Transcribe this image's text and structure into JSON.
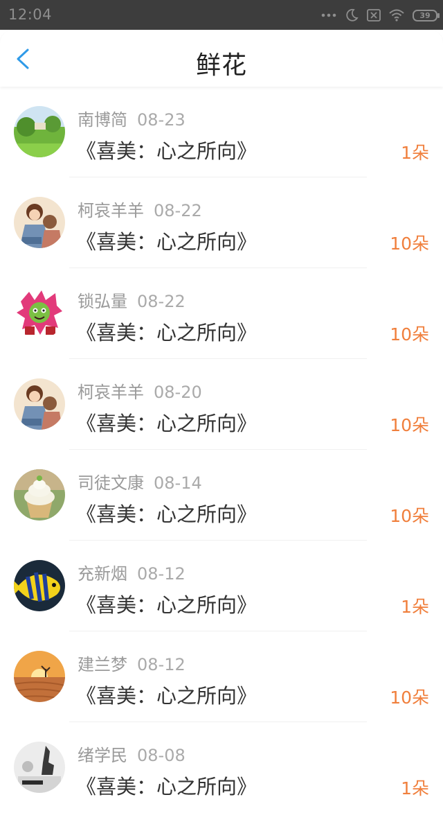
{
  "status_bar": {
    "time": "12:04",
    "battery": "39"
  },
  "header": {
    "title": "鲜花"
  },
  "list": [
    {
      "name": "南博简",
      "date": "08-23",
      "book": "《喜美：心之所向》",
      "count": "1朵",
      "avatar": "landscape"
    },
    {
      "name": "柯哀羊羊",
      "date": "08-22",
      "book": "《喜美：心之所向》",
      "count": "10朵",
      "avatar": "anime-couple"
    },
    {
      "name": "锁弘量",
      "date": "08-22",
      "book": "《喜美：心之所向》",
      "count": "10朵",
      "avatar": "cartoon-character"
    },
    {
      "name": "柯哀羊羊",
      "date": "08-20",
      "book": "《喜美：心之所向》",
      "count": "10朵",
      "avatar": "anime-couple"
    },
    {
      "name": "司徒文康",
      "date": "08-14",
      "book": "《喜美：心之所向》",
      "count": "10朵",
      "avatar": "cupcake"
    },
    {
      "name": "充新烟",
      "date": "08-12",
      "book": "《喜美：心之所向》",
      "count": "1朵",
      "avatar": "tropical-fish"
    },
    {
      "name": "建兰梦",
      "date": "08-12",
      "book": "《喜美：心之所向》",
      "count": "10朵",
      "avatar": "desert-sunset"
    },
    {
      "name": "绪学民",
      "date": "08-08",
      "book": "《喜美：心之所向》",
      "count": "1朵",
      "avatar": "black-white-photo"
    }
  ],
  "colors": {
    "accent": "#2f9ae8",
    "count": "#f07f3c",
    "status_bar": "#3d3d3d"
  }
}
